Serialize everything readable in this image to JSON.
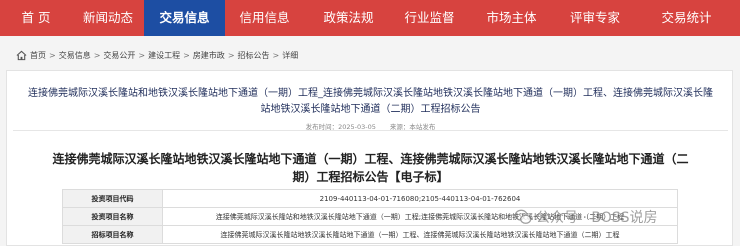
{
  "nav": {
    "items": [
      {
        "label": "首 页"
      },
      {
        "label": "新闻动态"
      },
      {
        "label": "交易信息",
        "active": true
      },
      {
        "label": "信用信息"
      },
      {
        "label": "政策法规"
      },
      {
        "label": "行业监督"
      },
      {
        "label": "市场主体"
      },
      {
        "label": "评审专家"
      },
      {
        "label": "交易统计"
      }
    ]
  },
  "breadcrumb": {
    "items": [
      "首页",
      "交易信息",
      "交易公开",
      "建设工程",
      "房建市政",
      "招标公告",
      "详细"
    ],
    "separator": ">"
  },
  "article": {
    "title": "连接佛莞城际汉溪长隆站和地铁汉溪长隆站地下通道（一期）工程_连接佛莞城际汉溪长隆站地铁汉溪长隆站地下通道（一期）工程、连接佛莞城际汉溪长隆站地铁汉溪长隆站地下通道（二期）工程招标公告",
    "publish_time": "发布时间：2025-03-05",
    "source": "来源：本站发布",
    "notice_title": "连接佛莞城际汉溪长隆站地铁汉溪长隆站地下通道（一期）工程、连接佛莞城际汉溪长隆站地铁汉溪长隆站地下通道（二期）工程招标公告【电子标】"
  },
  "info_table": {
    "rows": [
      {
        "label": "投资项目代码",
        "value": "2109-440113-04-01-716080;2105-440113-04-01-762604"
      },
      {
        "label": "投资项目名称",
        "value": "连接佛莞城际汉溪长隆站和地铁汉溪长隆站地下通道（一期）工程;连接佛莞城际汉溪长隆站和地铁汉溪长隆站地下通道（二期）工程"
      },
      {
        "label": "招标项目名称",
        "value": "连接佛莞城际汉溪长隆站地铁汉溪长隆站地下通道（一期）工程、连接佛莞城际汉溪长隆站地铁汉溪长隆站地下通道（二期）工程"
      }
    ]
  },
  "watermark": {
    "text": "公众号 · BOSS说房"
  },
  "colors": {
    "nav_bg": "#d7433f",
    "nav_active_bg": "#1d4ea3",
    "title_color": "#1f2d5a"
  }
}
